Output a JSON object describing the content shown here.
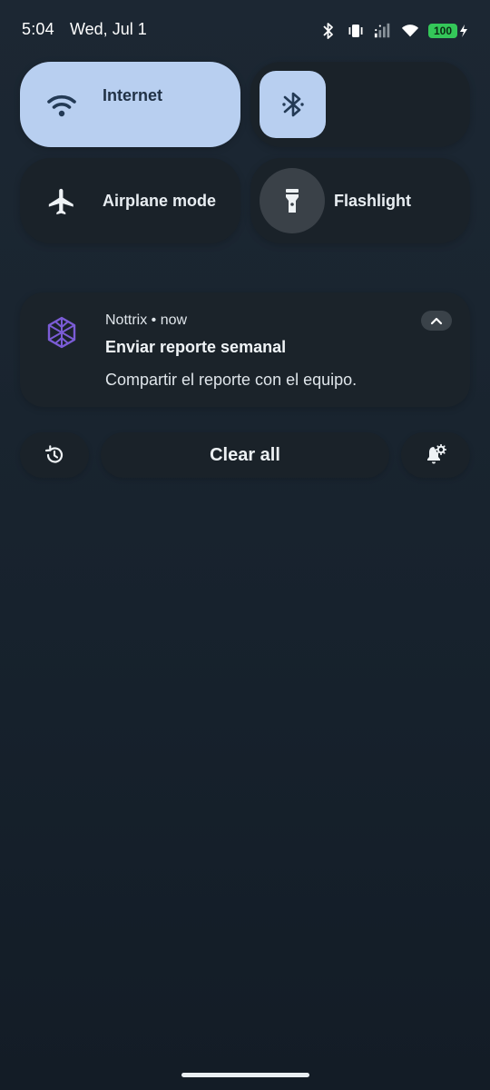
{
  "status_bar": {
    "time": "5:04",
    "date": "Wed, Jul 1",
    "battery_level": "100",
    "icons": [
      "bluetooth-icon",
      "vibrate-icon",
      "signal-icon",
      "wifi-icon",
      "battery-icon"
    ]
  },
  "quick_settings": {
    "internet": {
      "label": "Internet",
      "icon": "wifi-icon",
      "active": true
    },
    "bluetooth": {
      "icon": "bluetooth-icon",
      "active": true
    },
    "airplane": {
      "label": "Airplane mode",
      "icon": "airplane-icon",
      "active": false
    },
    "flashlight": {
      "label": "Flashlight",
      "icon": "flashlight-icon",
      "active": false
    }
  },
  "notification": {
    "app_line": "Nottrix • now",
    "title": "Enviar reporte semanal",
    "text": "Compartir el reporte con el equipo.",
    "icon": "nottrix-app-icon",
    "accent_color": "#7b5cd6"
  },
  "actions": {
    "clear_all": "Clear all",
    "history_icon": "history-icon",
    "settings_icon": "notification-settings-icon"
  },
  "colors": {
    "active_tile": "#b8cff0",
    "background": "#17222d",
    "battery": "#34c759"
  }
}
